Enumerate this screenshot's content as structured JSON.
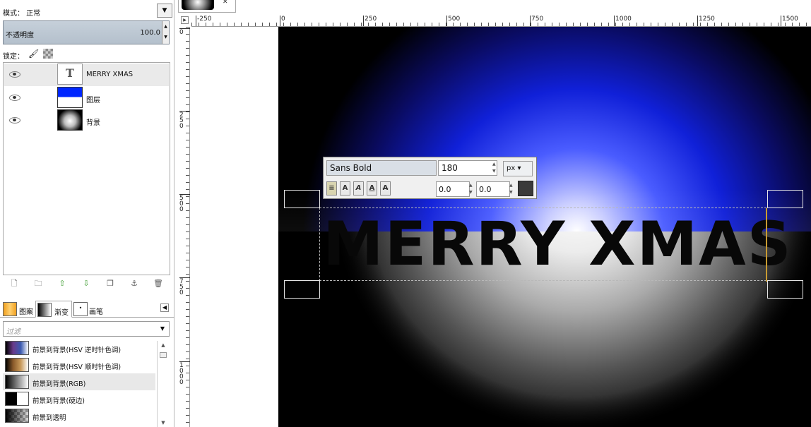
{
  "layers_panel": {
    "mode_label": "模式： 正常",
    "mode_dropdown": "▼",
    "opacity_label": "不透明度",
    "opacity_value": "100.0",
    "lock_label": "锁定：",
    "layers": [
      {
        "name": "MERRY XMAS",
        "thumb": "text-layer",
        "thumb_glyph": "T",
        "selected": true
      },
      {
        "name": "图层",
        "thumb": "blue-white-layer",
        "selected": false
      },
      {
        "name": "背景",
        "thumb": "radial-background",
        "selected": false
      }
    ],
    "toolbar_icons": [
      "new-layer-icon",
      "new-group-icon",
      "raise-layer-icon",
      "lower-layer-icon",
      "duplicate-layer-icon",
      "anchor-layer-icon",
      "delete-layer-icon"
    ]
  },
  "dock_tabs": [
    {
      "label": "图案",
      "active": false
    },
    {
      "label": "渐变",
      "active": true
    },
    {
      "label": "画笔",
      "active": false
    }
  ],
  "filter": {
    "placeholder": "过滤"
  },
  "gradients": [
    {
      "label": "前景到背景(HSV 逆时针色调)",
      "selected": false
    },
    {
      "label": "前景到背景(HSV 顺时针色调)",
      "selected": false
    },
    {
      "label": "前景到背景(RGB)",
      "selected": true
    },
    {
      "label": "前景到背景(硬边)",
      "selected": false
    },
    {
      "label": "前景到透明",
      "selected": false
    }
  ],
  "canvas": {
    "ruler_h_labels": [
      "-250",
      "0",
      "250",
      "500",
      "750",
      "1000",
      "1250",
      "1500"
    ],
    "ruler_v_labels": [
      "0",
      "250",
      "500",
      "750",
      "1000"
    ],
    "text": "MERRY XMAS"
  },
  "text_toolbar": {
    "font": "Sans Bold",
    "size": "180",
    "unit": "px",
    "letter_spacing": "0.0",
    "line_spacing": "0.0",
    "color": "#3a3a3a"
  }
}
